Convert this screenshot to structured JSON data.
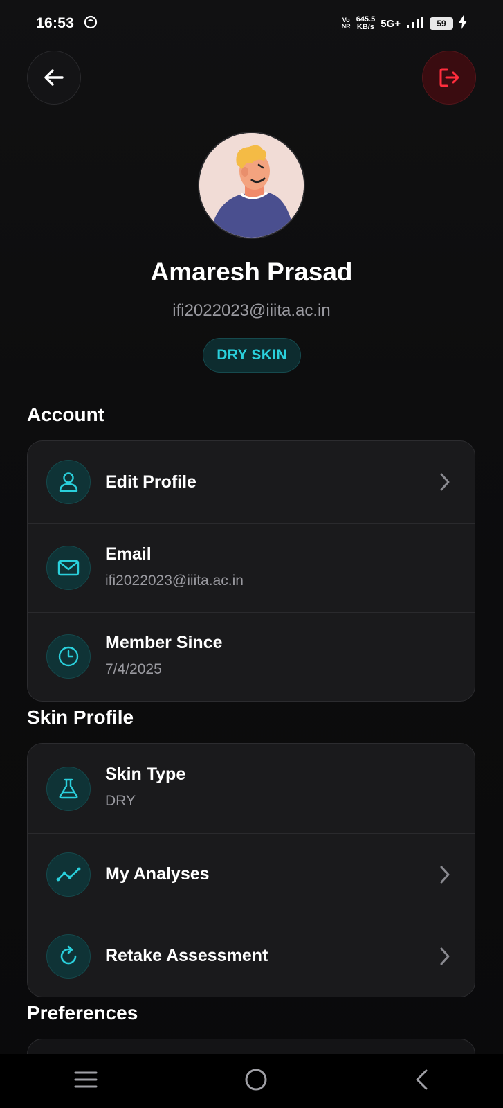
{
  "status_bar": {
    "time": "16:53",
    "volte_top": "Vo",
    "volte_bottom": "NR",
    "speed_value": "645.5",
    "speed_unit": "KB/s",
    "network": "5G+",
    "battery": "59"
  },
  "profile": {
    "name": "Amaresh Prasad",
    "email": "ifi2022023@iiita.ac.in",
    "skin_badge": "DRY SKIN"
  },
  "sections": {
    "account_title": "Account",
    "skin_profile_title": "Skin Profile",
    "preferences_title": "Preferences"
  },
  "account": {
    "edit_profile_label": "Edit Profile",
    "email_label": "Email",
    "email_value": "ifi2022023@iiita.ac.in",
    "member_since_label": "Member Since",
    "member_since_value": "7/4/2025"
  },
  "skin_profile": {
    "skin_type_label": "Skin Type",
    "skin_type_value": "DRY",
    "my_analyses_label": "My Analyses",
    "retake_label": "Retake Assessment"
  },
  "colors": {
    "accent": "#2ad0dc",
    "logout": "#ff2d3d",
    "background": "#0b0b0c",
    "card": "#1a1a1c"
  },
  "icons": {
    "back": "arrow-left-icon",
    "logout": "logout-icon",
    "edit_profile": "user-icon",
    "email": "mail-icon",
    "member_since": "clock-icon",
    "skin_type": "flask-icon",
    "my_analyses": "trend-icon",
    "retake": "refresh-icon",
    "chevron": "chevron-right-icon"
  }
}
